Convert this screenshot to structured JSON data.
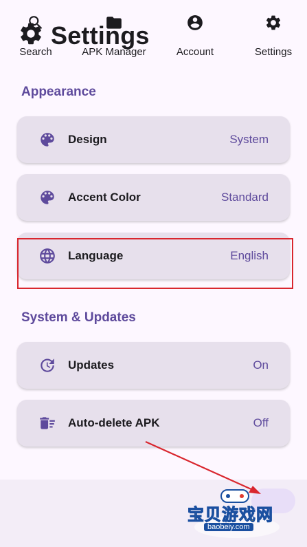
{
  "header": {
    "title": "Settings",
    "icon": "gear-icon"
  },
  "sections": {
    "appearance": {
      "title": "Appearance",
      "items": [
        {
          "label": "Design",
          "value": "System",
          "icon": "palette-icon"
        },
        {
          "label": "Accent Color",
          "value": "Standard",
          "icon": "palette-icon"
        },
        {
          "label": "Language",
          "value": "English",
          "icon": "globe-icon"
        }
      ]
    },
    "system": {
      "title": "System & Updates",
      "items": [
        {
          "label": "Updates",
          "value": "On",
          "icon": "update-icon"
        },
        {
          "label": "Auto-delete APK",
          "value": "Off",
          "icon": "delete-list-icon"
        }
      ]
    }
  },
  "nav": {
    "items": [
      {
        "label": "Search",
        "icon": "search-icon"
      },
      {
        "label": "APK Manager",
        "icon": "folder-icon"
      },
      {
        "label": "Account",
        "icon": "account-icon"
      },
      {
        "label": "Settings",
        "icon": "gear-icon",
        "active": true
      }
    ]
  },
  "watermark": {
    "text": "宝贝游戏网",
    "url": "baobeiy.com"
  },
  "colors": {
    "background": "#fdf7ff",
    "accent": "#5e4a9c",
    "card": "#e7e0ec",
    "highlight": "#d9262e"
  }
}
